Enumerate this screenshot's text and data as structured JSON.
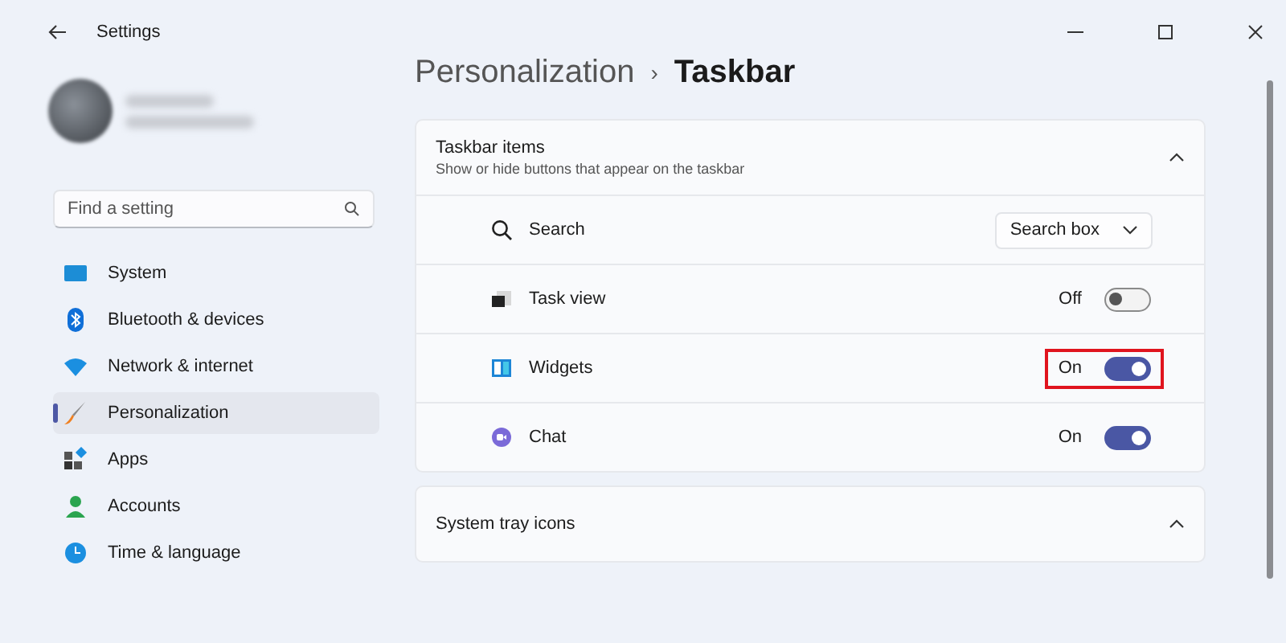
{
  "window": {
    "title": "Settings"
  },
  "search": {
    "placeholder": "Find a setting"
  },
  "sidebar": {
    "items": [
      {
        "label": "System",
        "selected": false
      },
      {
        "label": "Bluetooth & devices",
        "selected": false
      },
      {
        "label": "Network & internet",
        "selected": false
      },
      {
        "label": "Personalization",
        "selected": true
      },
      {
        "label": "Apps",
        "selected": false
      },
      {
        "label": "Accounts",
        "selected": false
      },
      {
        "label": "Time & language",
        "selected": false
      }
    ]
  },
  "breadcrumb": {
    "parent": "Personalization",
    "separator": "›",
    "current": "Taskbar"
  },
  "sections": [
    {
      "title": "Taskbar items",
      "subtitle": "Show or hide buttons that appear on the taskbar",
      "expanded": true,
      "items": [
        {
          "kind": "dropdown",
          "label": "Search",
          "value": "Search box",
          "highlighted": false
        },
        {
          "kind": "toggle",
          "label": "Task view",
          "on": false,
          "state_label": "Off",
          "highlighted": false
        },
        {
          "kind": "toggle",
          "label": "Widgets",
          "on": true,
          "state_label": "On",
          "highlighted": true
        },
        {
          "kind": "toggle",
          "label": "Chat",
          "on": true,
          "state_label": "On",
          "highlighted": false
        }
      ]
    },
    {
      "title": "System tray icons",
      "expanded": true
    }
  ]
}
